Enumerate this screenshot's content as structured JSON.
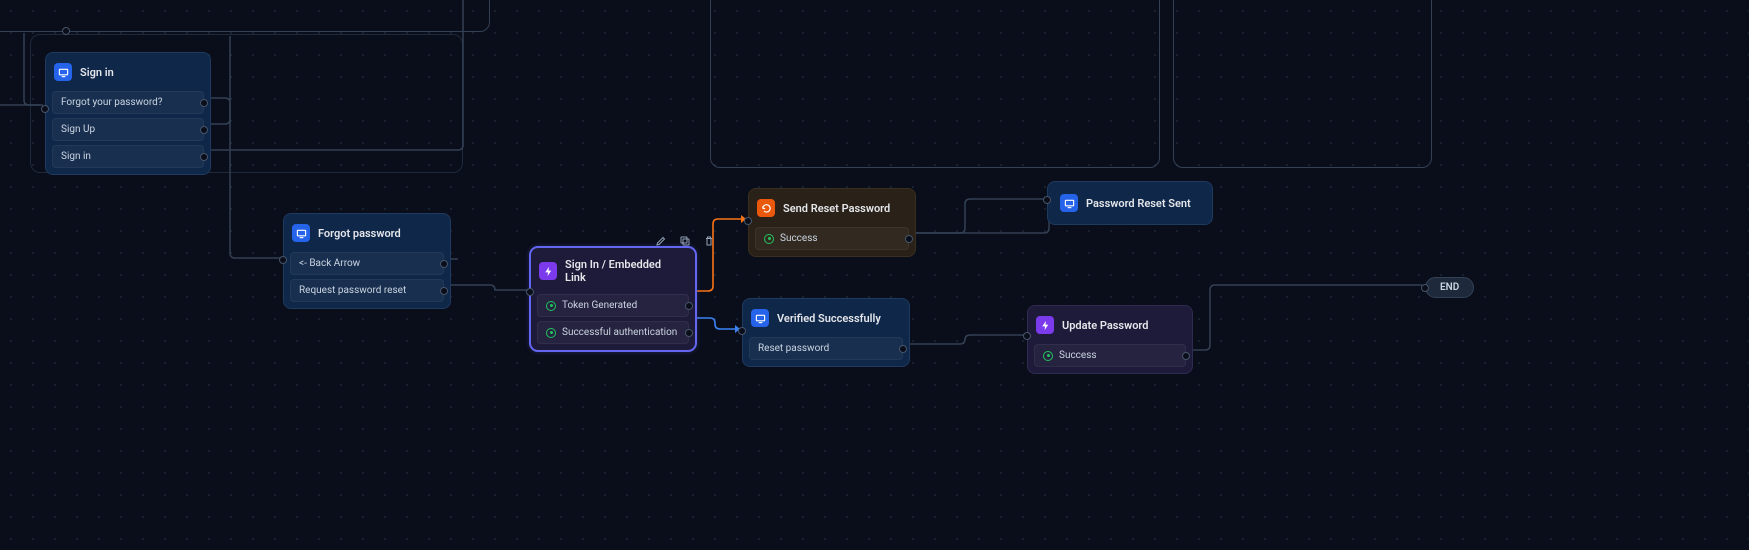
{
  "colors": {
    "background": "#0a0e1a",
    "grid_dot": "#1e293b",
    "edge_default": "#334155",
    "edge_orange": "#f97316",
    "edge_blue": "#3b82f6",
    "node_selected": "#6366f1"
  },
  "end": {
    "label": "END"
  },
  "signin": {
    "title": "Sign in",
    "icon": "screen-icon",
    "rows": {
      "forgot": "Forgot your password?",
      "signup": "Sign Up",
      "signin": "Sign in"
    }
  },
  "forgot": {
    "title": "Forgot password",
    "icon": "screen-icon",
    "rows": {
      "back": "<- Back Arrow",
      "request": "Request password reset"
    }
  },
  "embedded": {
    "title": "Sign In / Embedded Link",
    "icon": "bolt-icon",
    "rows": {
      "token": "Token Generated",
      "auth": "Successful authentication"
    }
  },
  "send_reset": {
    "title": "Send Reset Password",
    "icon": "cycle-icon",
    "rows": {
      "success": "Success"
    }
  },
  "reset_sent": {
    "title": "Password Reset Sent",
    "icon": "screen-icon"
  },
  "verified": {
    "title": "Verified Successfully",
    "icon": "screen-icon",
    "rows": {
      "reset": "Reset password"
    }
  },
  "update": {
    "title": "Update Password",
    "icon": "bolt-icon",
    "rows": {
      "success": "Success"
    }
  },
  "toolbar": {
    "edit": "edit-icon",
    "copy": "copy-icon",
    "delete": "trash-icon"
  }
}
